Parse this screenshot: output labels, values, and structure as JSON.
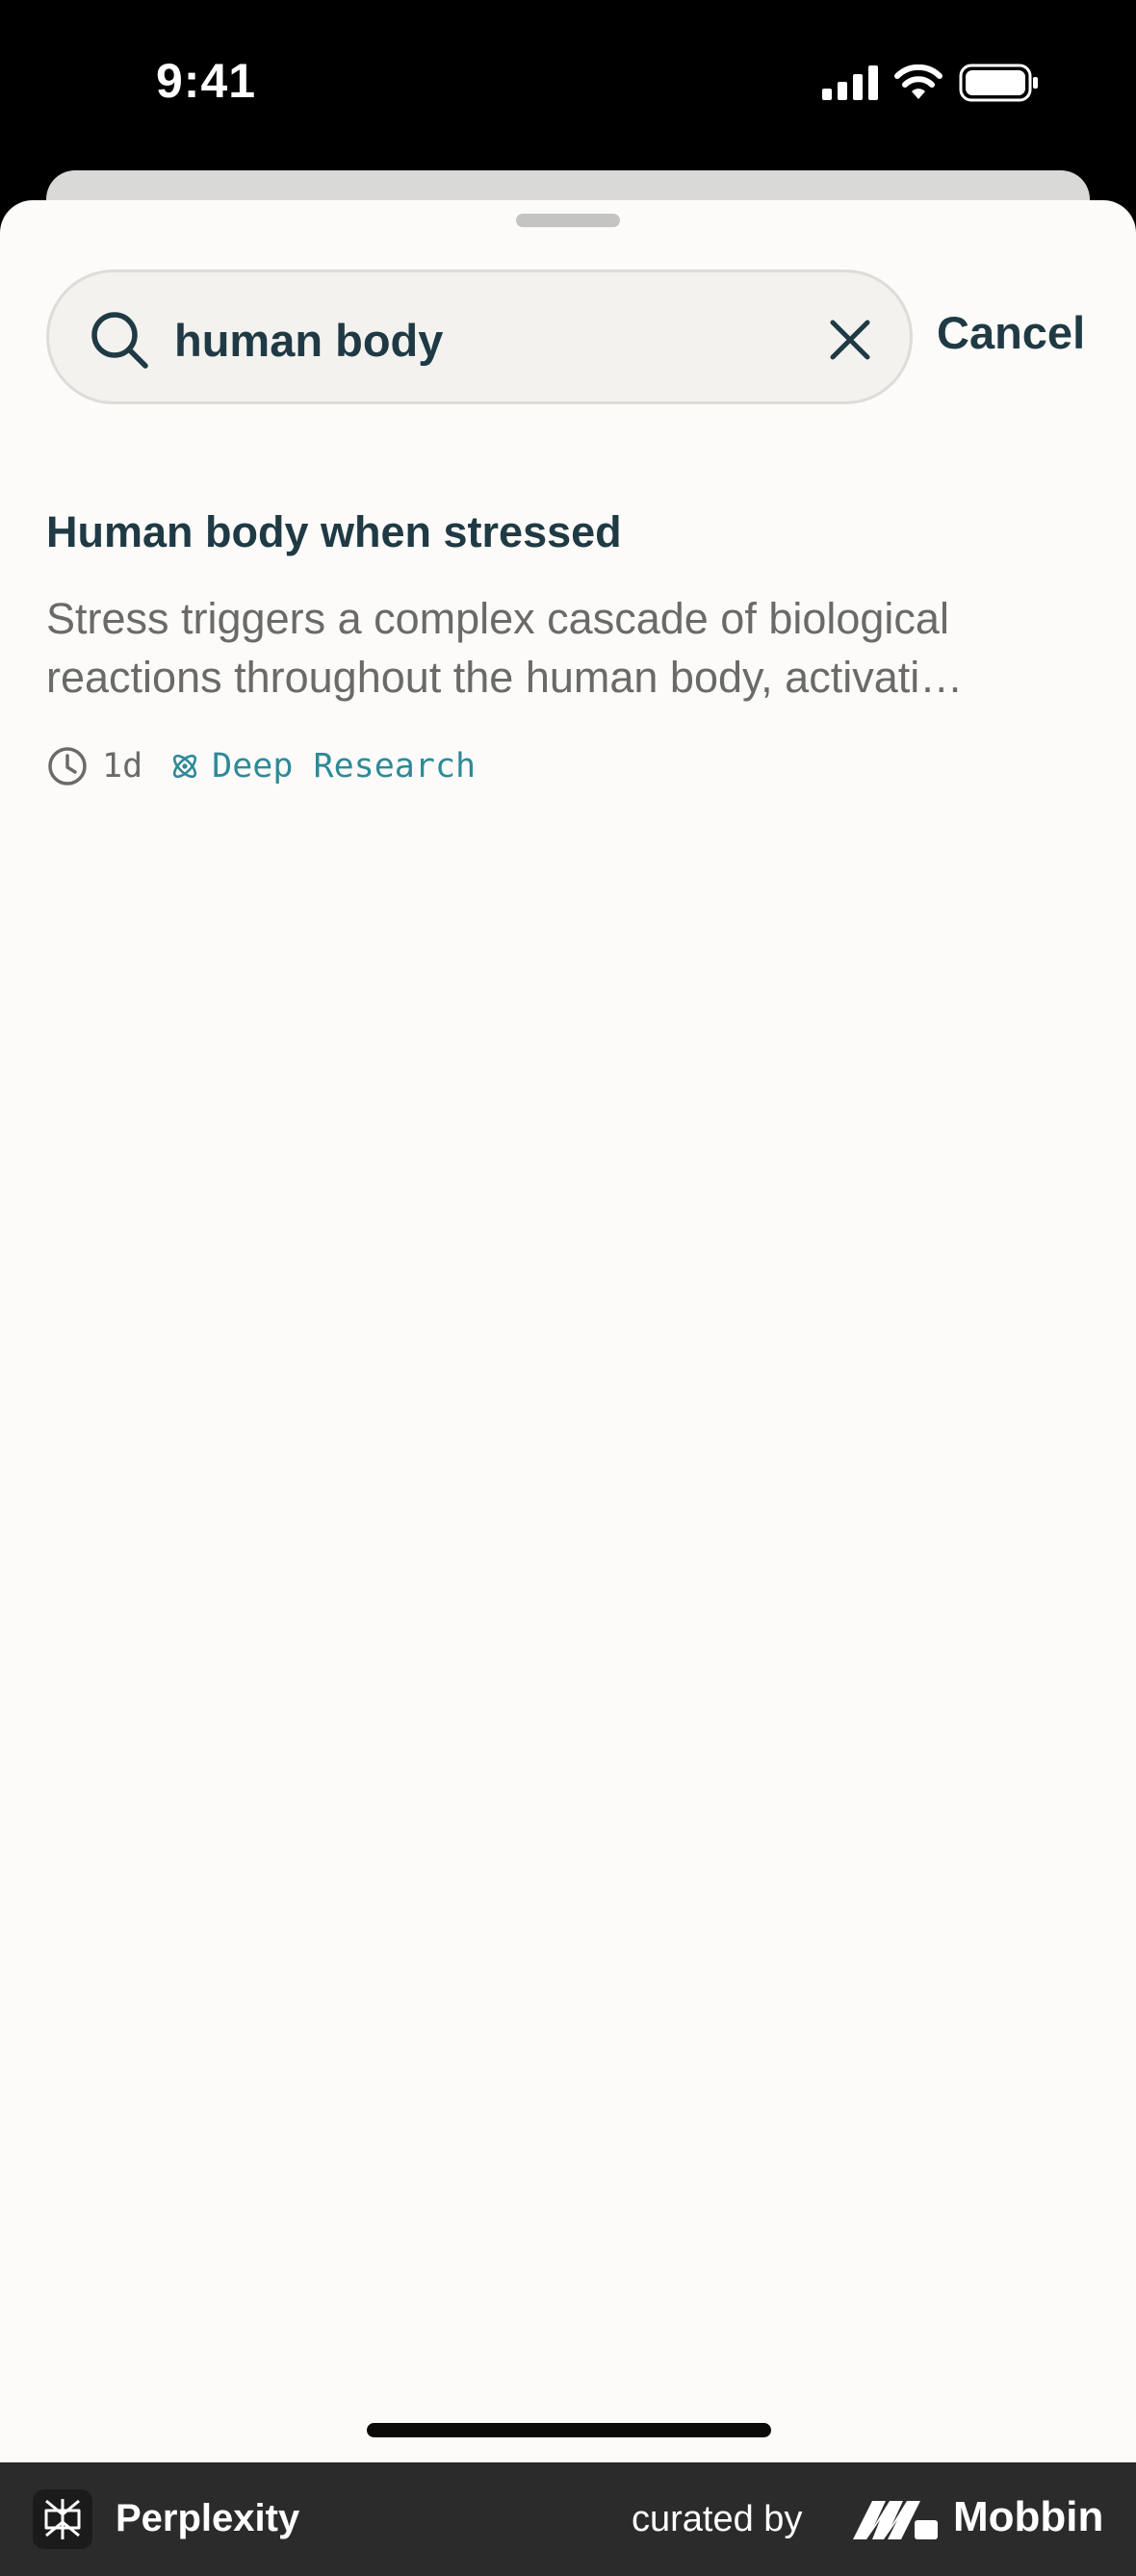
{
  "status_bar": {
    "time": "9:41"
  },
  "search": {
    "query": "human body",
    "cancel_label": "Cancel"
  },
  "results": [
    {
      "title": "Human body when stressed",
      "snippet": "Stress triggers a complex cascade of biological reactions throughout the human body, activati…",
      "age": "1d",
      "tag": "Deep Research"
    }
  ],
  "footer": {
    "brand": "Perplexity",
    "curated_by": "curated by",
    "mobbin": "Mobbin"
  },
  "colors": {
    "accent": "#2e8a97",
    "text_primary": "#1f3a44",
    "text_secondary": "#6a6a68",
    "sheet_background": "#fcfbf9"
  },
  "icons": {
    "search": "search-icon",
    "clear": "close-icon",
    "time": "clock-icon",
    "tag": "atom-icon"
  }
}
